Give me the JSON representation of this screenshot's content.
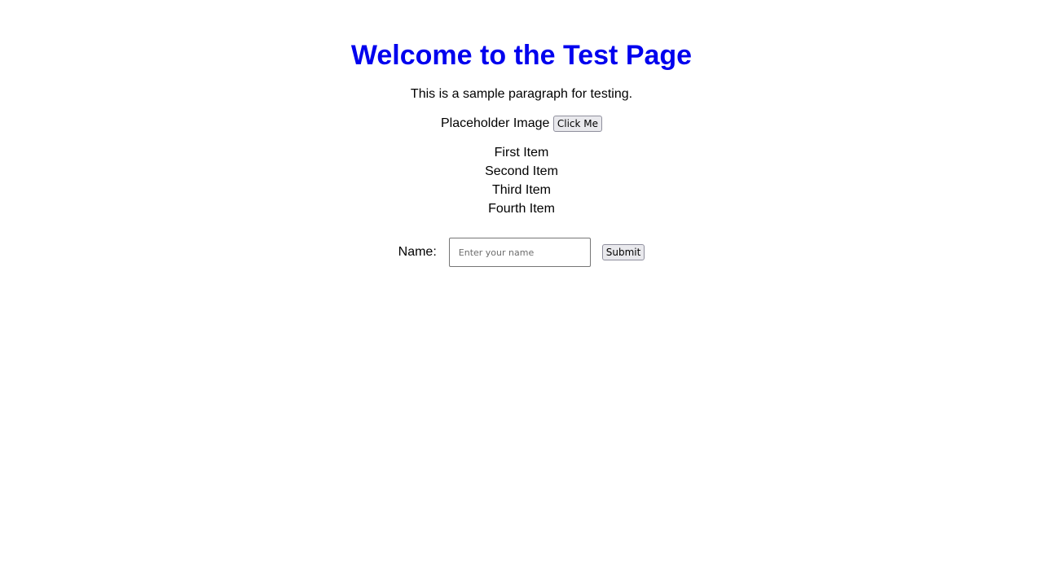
{
  "header": {
    "title": "Welcome to the Test Page"
  },
  "intro": {
    "paragraph": "This is a sample paragraph for testing."
  },
  "media": {
    "image_alt": "Placeholder Image",
    "click_button_label": "Click Me"
  },
  "items": [
    "First Item",
    "Second Item",
    "Third Item",
    "Fourth Item"
  ],
  "form": {
    "name_label": "Name:",
    "name_value": "",
    "name_placeholder": "Enter your name",
    "submit_label": "Submit"
  },
  "colors": {
    "title": "#0000ee",
    "text": "#000000",
    "background": "#ffffff"
  }
}
